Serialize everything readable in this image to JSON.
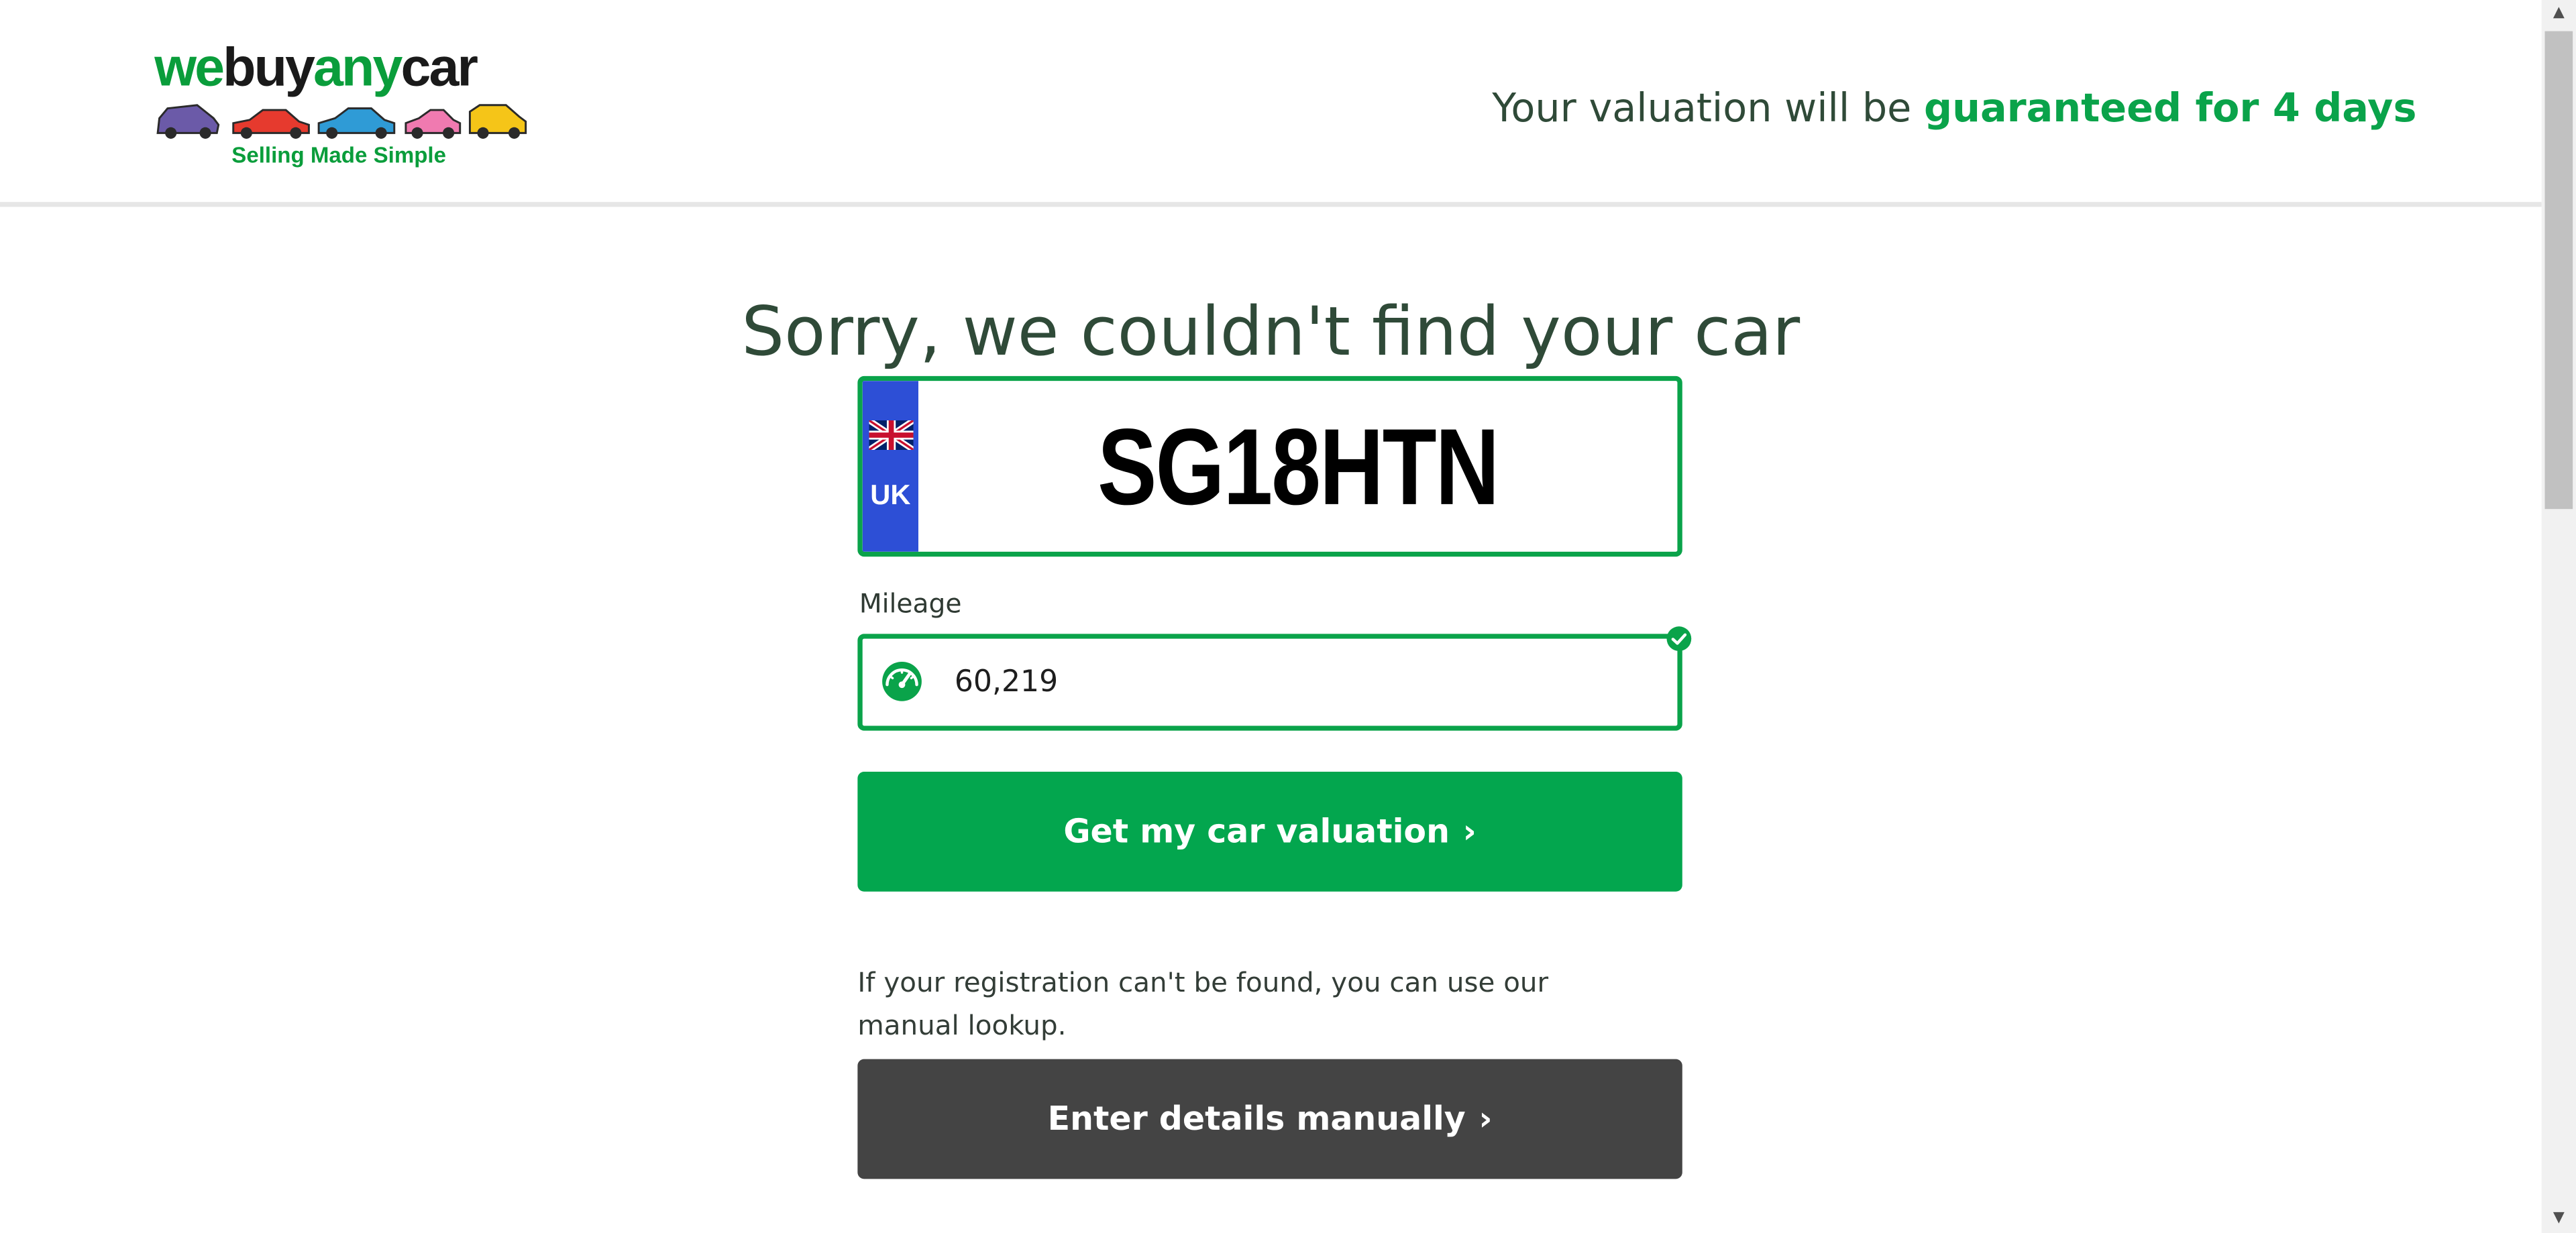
{
  "header": {
    "logo": {
      "word_part1": "we",
      "word_part2": "buy",
      "word_part3": "any",
      "word_part4": "car",
      "tagline": "Selling Made Simple",
      "car_colors": [
        "#6b5aa8",
        "#e63a2e",
        "#2f9bd6",
        "#f07ab0",
        "#f5c518"
      ]
    },
    "guarantee_prefix": "Your valuation will be ",
    "guarantee_strong": "guaranteed for 4 days"
  },
  "main": {
    "title": "Sorry, we couldn't find your car",
    "plate": {
      "country": "UK",
      "registration": "SG18HTN"
    },
    "mileage": {
      "label": "Mileage",
      "value": "60,219"
    },
    "valuation_button": {
      "label": "Get my car valuation",
      "chevron": "›"
    },
    "note": "If your registration can't be found, you can use our manual lookup.",
    "manual_button": {
      "label": "Enter details manually",
      "chevron": "›"
    }
  },
  "scrollbar": {
    "up": "▲",
    "down": "▼"
  },
  "colors": {
    "brand_green": "#0aa34a",
    "button_green": "#03a64e",
    "button_dark": "#444444",
    "plate_blue": "#2d4fd6",
    "heading_text": "#2f4a38"
  }
}
